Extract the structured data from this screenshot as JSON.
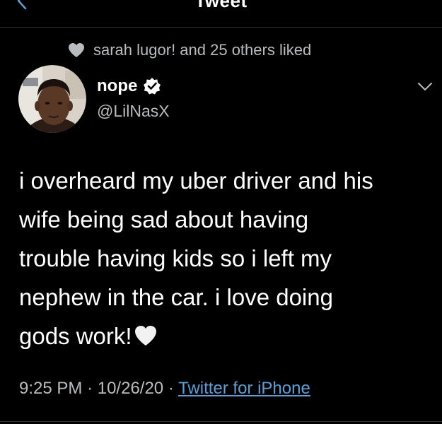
{
  "header": {
    "title": "Tweet",
    "back_icon": "chevron-left-icon"
  },
  "social_context": {
    "icon": "heart-icon",
    "text": "sarah lugor! and 25 others liked"
  },
  "author": {
    "display_name": "nope",
    "handle": "@LilNasX",
    "verified": true,
    "verified_color": "#ffffff",
    "avatar_icon": "avatar"
  },
  "more_menu": {
    "icon": "chevron-down-icon"
  },
  "tweet": {
    "lines": [
      "i overheard my uber driver and his",
      "wife being sad about having",
      "trouble having kids so i left my",
      "nephew in the car. i love doing",
      "gods work!"
    ],
    "trailing_emoji": "white-heart-icon"
  },
  "meta": {
    "time": "9:25 PM",
    "separator": "·",
    "date": "10/26/20",
    "source": "Twitter for iPhone"
  },
  "colors": {
    "background": "#000000",
    "text": "#ffffff",
    "secondary_text": "#b9bcbf",
    "link": "#5b9fd6",
    "divider": "#2f3336"
  }
}
